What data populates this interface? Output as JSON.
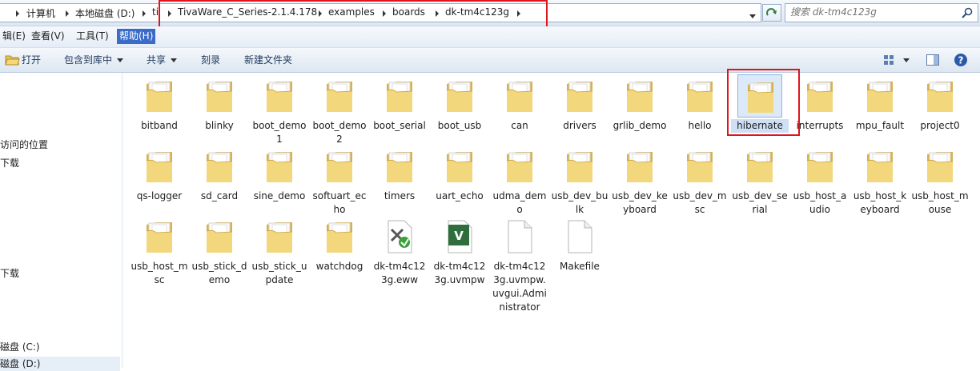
{
  "address": {
    "crumbs": [
      "计算机",
      "本地磁盘 (D:)",
      "ti",
      "TivaWare_C_Series-2.1.4.178",
      "examples",
      "boards",
      "dk-tm4c123g"
    ]
  },
  "search": {
    "placeholder": "搜索 dk-tm4c123g"
  },
  "menu": [
    "辑(E)",
    "查看(V)",
    "工具(T)",
    "帮助(H)"
  ],
  "toolbar": {
    "open": "打开",
    "include": "包含到库中",
    "share": "共享",
    "burn": "刻录",
    "new_folder": "新建文件夹"
  },
  "nav": [
    "访问的位置",
    "下载",
    "下载",
    "磁盘 (C:)",
    "磁盘 (D:)"
  ],
  "files": [
    {
      "label": "bitband",
      "type": "folder"
    },
    {
      "label": "blinky",
      "type": "folder"
    },
    {
      "label": "boot_demo1",
      "type": "folder"
    },
    {
      "label": "boot_demo2",
      "type": "folder"
    },
    {
      "label": "boot_serial",
      "type": "folder"
    },
    {
      "label": "boot_usb",
      "type": "folder"
    },
    {
      "label": "can",
      "type": "folder"
    },
    {
      "label": "drivers",
      "type": "folder"
    },
    {
      "label": "grlib_demo",
      "type": "folder"
    },
    {
      "label": "hello",
      "type": "folder"
    },
    {
      "label": "hibernate",
      "type": "folder",
      "selected": true
    },
    {
      "label": "interrupts",
      "type": "folder"
    },
    {
      "label": "mpu_fault",
      "type": "folder"
    },
    {
      "label": "project0",
      "type": "folder"
    },
    {
      "label": "qs-logger",
      "type": "folder"
    },
    {
      "label": "sd_card",
      "type": "folder"
    },
    {
      "label": "sine_demo",
      "type": "folder"
    },
    {
      "label": "softuart_echo",
      "type": "folder"
    },
    {
      "label": "timers",
      "type": "folder"
    },
    {
      "label": "uart_echo",
      "type": "folder"
    },
    {
      "label": "udma_demo",
      "type": "folder"
    },
    {
      "label": "usb_dev_bulk",
      "type": "folder"
    },
    {
      "label": "usb_dev_keyboard",
      "type": "folder"
    },
    {
      "label": "usb_dev_msc",
      "type": "folder"
    },
    {
      "label": "usb_dev_serial",
      "type": "folder"
    },
    {
      "label": "usb_host_audio",
      "type": "folder"
    },
    {
      "label": "usb_host_keyboard",
      "type": "folder"
    },
    {
      "label": "usb_host_mouse",
      "type": "folder"
    },
    {
      "label": "usb_host_msc",
      "type": "folder"
    },
    {
      "label": "usb_stick_demo",
      "type": "folder"
    },
    {
      "label": "usb_stick_update",
      "type": "folder"
    },
    {
      "label": "watchdog",
      "type": "folder"
    },
    {
      "label": "dk-tm4c123g.eww",
      "type": "eww"
    },
    {
      "label": "dk-tm4c123g.uvmpw",
      "type": "uvmpw"
    },
    {
      "label": "dk-tm4c123g.uvmpw.uvgui.Administrator",
      "type": "file"
    },
    {
      "label": "Makefile",
      "type": "file"
    }
  ],
  "colors": {
    "highlight": "#e0141e",
    "menu_active": "#3a6bc9"
  }
}
